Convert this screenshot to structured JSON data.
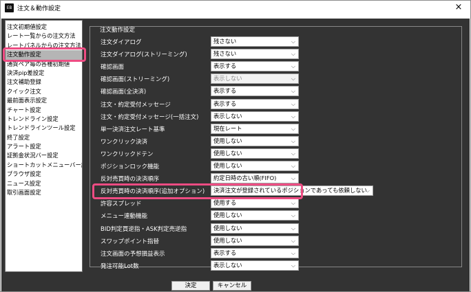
{
  "window": {
    "icon_text": "EB",
    "title": "注文＆動作設定",
    "close": "×"
  },
  "sidebar": {
    "items": [
      {
        "label": "注文初期値設定"
      },
      {
        "label": "レート一覧からの注文方法"
      },
      {
        "label": "レートパネルからの注文方法"
      },
      {
        "label": "注文動作設定",
        "selected": true
      },
      {
        "label": "通貨ペア毎の各種初期値"
      },
      {
        "label": "決済pip差設定"
      },
      {
        "label": "注文補助登録"
      },
      {
        "label": "クイック注文"
      },
      {
        "label": "最前面表示設定"
      },
      {
        "label": "チャート設定"
      },
      {
        "label": "トレンドライン設定"
      },
      {
        "label": "トレンドラインツール設定"
      },
      {
        "label": "終了設定"
      },
      {
        "label": "アラート設定"
      },
      {
        "label": "証拠金状況バー設定"
      },
      {
        "label": "ショートカットメニューバー設定"
      },
      {
        "label": "ブラウザ設定"
      },
      {
        "label": "ニュース設定"
      },
      {
        "label": "取引画面設定"
      }
    ]
  },
  "group": {
    "title": "注文動作設定",
    "rows": [
      {
        "label": "注文ダイアログ",
        "value": "残さない",
        "disabled": false,
        "wide": false
      },
      {
        "label": "注文ダイアログ(ストリーミング)",
        "value": "残さない",
        "disabled": false,
        "wide": false
      },
      {
        "label": "確認画面",
        "value": "表示する",
        "disabled": false,
        "wide": false
      },
      {
        "label": "確認画面(ストリーミング)",
        "value": "表示しない",
        "disabled": true,
        "wide": false
      },
      {
        "label": "確認画面(全決済)",
        "value": "表示する",
        "disabled": false,
        "wide": false
      },
      {
        "label": "注文・約定受付メッセージ",
        "value": "表示する",
        "disabled": false,
        "wide": false
      },
      {
        "label": "注文・約定受付メッセージ(一括注文)",
        "value": "表示しない",
        "disabled": false,
        "wide": false
      },
      {
        "label": "単一決済注文レート基準",
        "value": "現在レート",
        "disabled": false,
        "wide": false
      },
      {
        "label": "ワンクリック決済",
        "value": "使用しない",
        "disabled": false,
        "wide": false
      },
      {
        "label": "ワンクリックドテン",
        "value": "使用しない",
        "disabled": false,
        "wide": false
      },
      {
        "label": "ポジションロック機能",
        "value": "使用しない",
        "disabled": false,
        "wide": false
      },
      {
        "label": "反対売買時の決済順序",
        "value": "約定日時の古い順(FIFO)",
        "disabled": false,
        "wide": false
      },
      {
        "label": "反対売買時の決済順序(追加オプション)",
        "value": "決済注文が登録されているポジションであっても依頼しない",
        "disabled": false,
        "wide": true
      },
      {
        "label": "許容スプレッド",
        "value": "使用する",
        "disabled": false,
        "wide": false
      },
      {
        "label": "メニュー連動機能",
        "value": "使用しない",
        "disabled": false,
        "wide": false
      },
      {
        "label": "BID判定買逆指・ASK判定売逆指",
        "value": "使用しない",
        "disabled": false,
        "wide": false
      },
      {
        "label": "スワップポイント指替",
        "value": "使用しない",
        "disabled": false,
        "wide": false
      },
      {
        "label": "注文画面の予想損益表示",
        "value": "表示する",
        "disabled": false,
        "wide": false
      },
      {
        "label": "発注可能Lot数",
        "value": "表示しない",
        "disabled": false,
        "wide": false
      }
    ]
  },
  "footer": {
    "ok_label": "決定",
    "cancel_label": "キャンセル"
  },
  "colors": {
    "panel_bg": "#333333",
    "highlight": "#ee4c83",
    "selected_item": "#b5b5b5"
  },
  "icons": {
    "dropdown": "chevron-down-icon",
    "close": "close-icon"
  }
}
